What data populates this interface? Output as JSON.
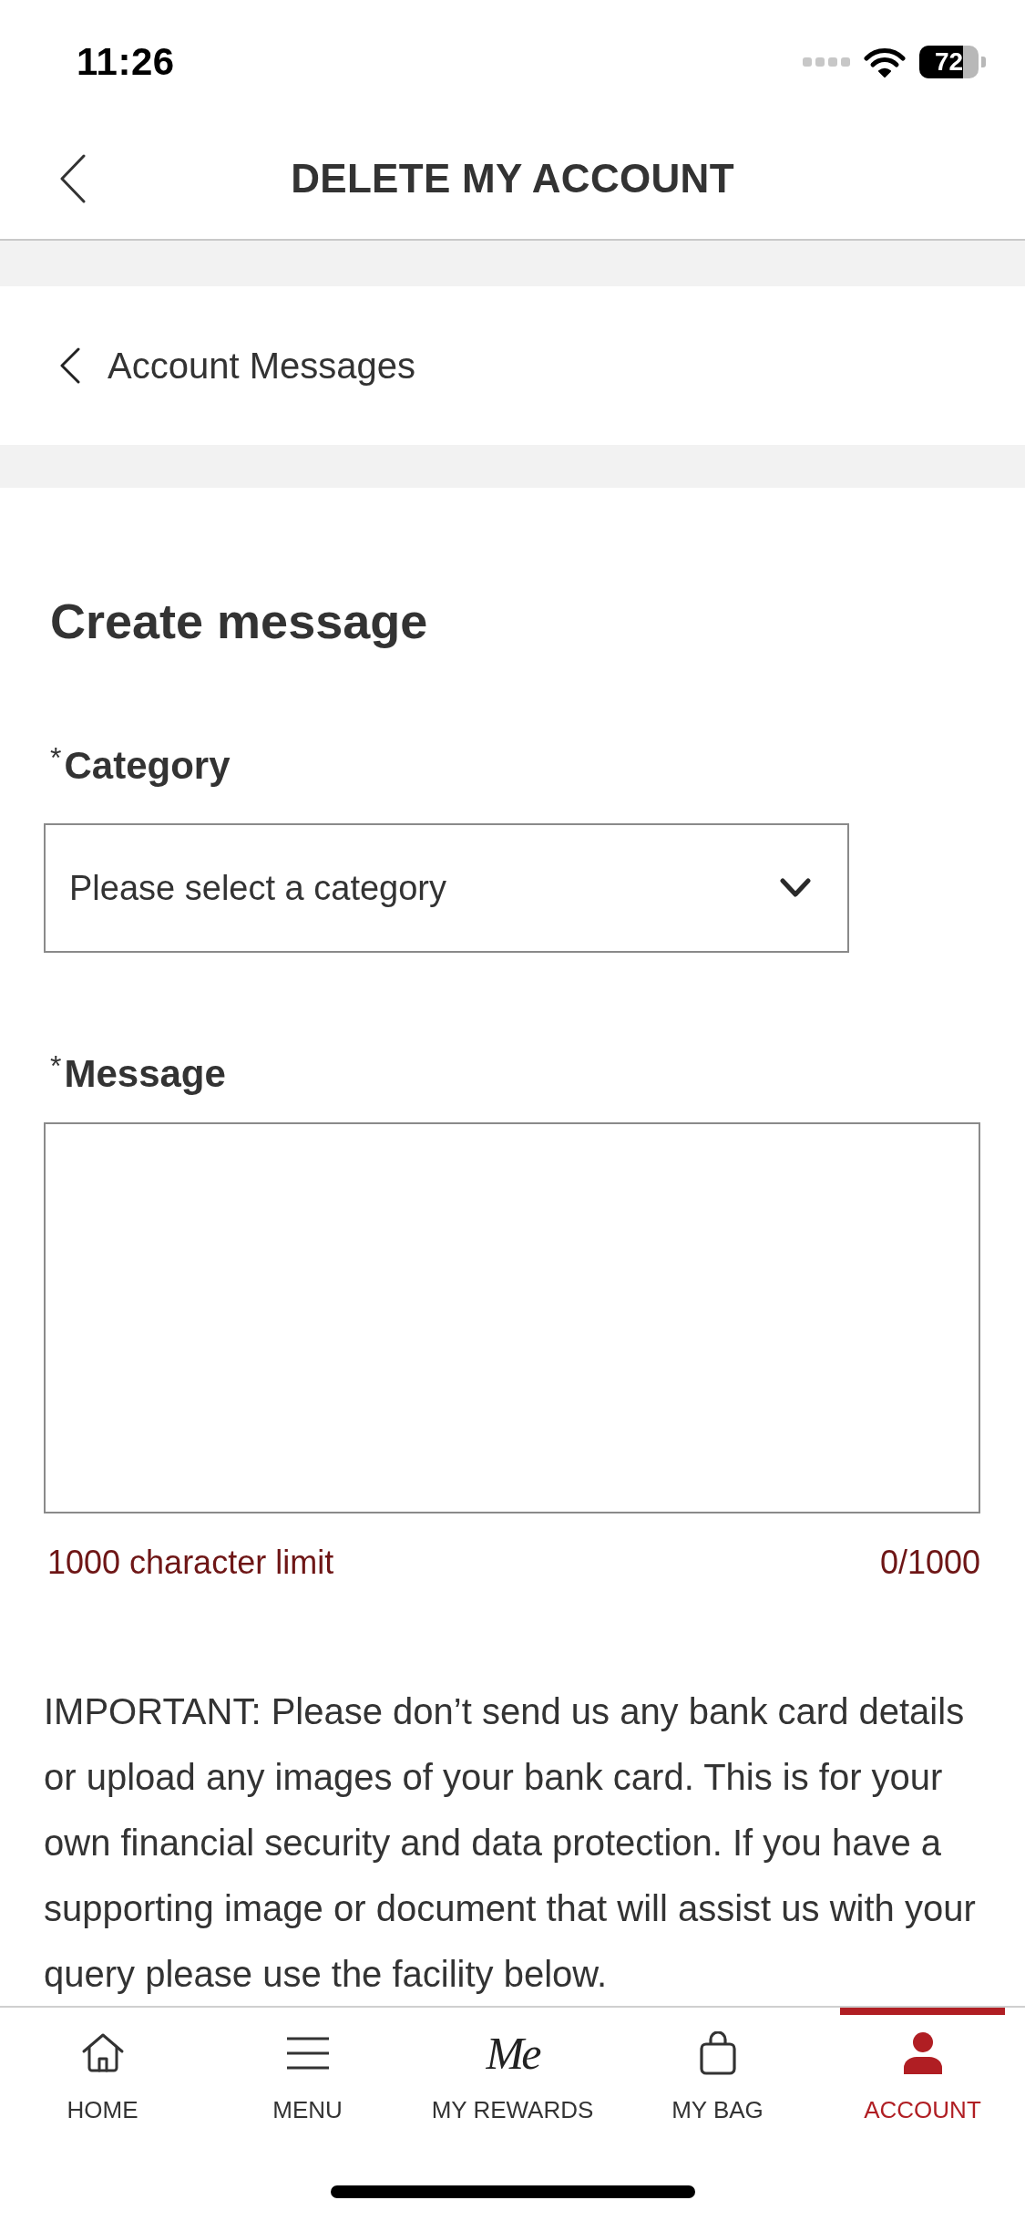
{
  "status_bar": {
    "time": "11:26",
    "battery": "72"
  },
  "header": {
    "title": "DELETE MY ACCOUNT"
  },
  "breadcrumb": {
    "label": "Account Messages"
  },
  "form": {
    "title": "Create message",
    "category": {
      "label": "$^{*}$Category",
      "placeholder": "Please select a category"
    },
    "message": {
      "label": "$^{*}$Message",
      "hint": "1000 character limit",
      "counter": "0/1000"
    },
    "notice": "IMPORTANT: Please don’t send us any bank card details or upload any images of your bank card. This is for your own financial security and data protection. If you have a supporting image or document that will assist us with your query please use the facility below."
  },
  "bottom_nav": [
    {
      "kind": "home",
      "label": "HOME",
      "selected": false
    },
    {
      "kind": "menu",
      "label": "MENU",
      "selected": false
    },
    {
      "kind": "logo",
      "logo": "Me",
      "label": "MY REWARDS",
      "selected": false
    },
    {
      "kind": "bag",
      "label": "MY BAG",
      "selected": false
    },
    {
      "kind": "person",
      "label": "ACCOUNT",
      "selected": true
    }
  ]
}
